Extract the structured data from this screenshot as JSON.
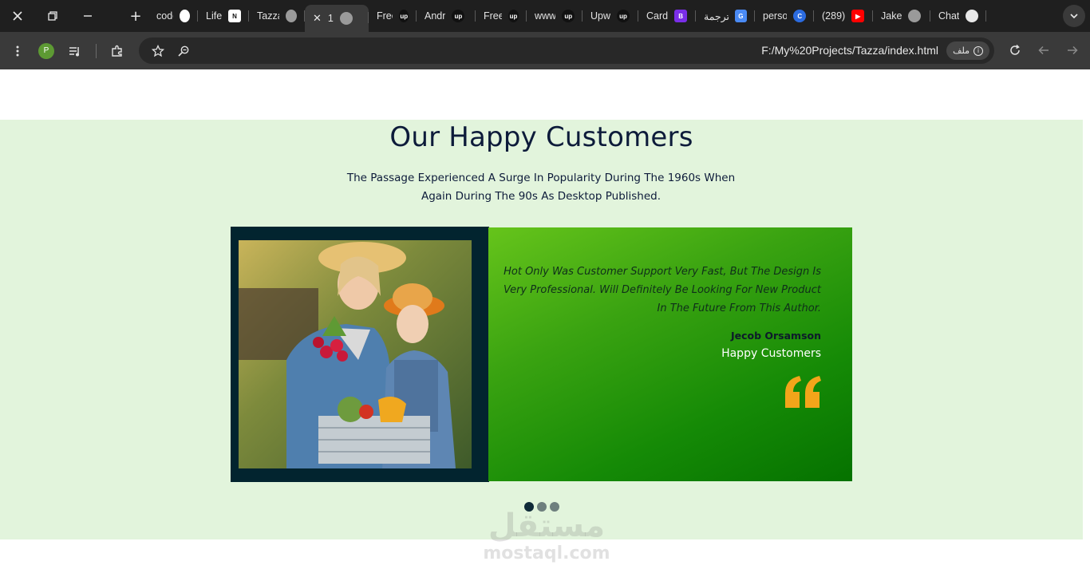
{
  "browser": {
    "tabs": [
      {
        "title": "code",
        "fav_color": "#ffffff",
        "fav_text": "",
        "fav_kind": "github"
      },
      {
        "title": "Life",
        "fav_color": "#ffffff",
        "fav_text": "N",
        "fav_kind": "notion"
      },
      {
        "title": "Tazza",
        "fav_color": "#9a9a9a",
        "fav_text": "",
        "fav_kind": "globe"
      },
      {
        "title": "1",
        "fav_color": "#9a9a9a",
        "fav_text": "",
        "fav_kind": "globe",
        "active": true
      },
      {
        "title": "Freel",
        "fav_color": "#111111",
        "fav_text": "up",
        "fav_kind": "upwork"
      },
      {
        "title": "Andr",
        "fav_color": "#111111",
        "fav_text": "up",
        "fav_kind": "upwork"
      },
      {
        "title": "Freel",
        "fav_color": "#111111",
        "fav_text": "up",
        "fav_kind": "upwork"
      },
      {
        "title": "www",
        "fav_color": "#111111",
        "fav_text": "up",
        "fav_kind": "upwork"
      },
      {
        "title": "Upw",
        "fav_color": "#111111",
        "fav_text": "up",
        "fav_kind": "upwork"
      },
      {
        "title": "Card",
        "fav_color": "#7a2ee8",
        "fav_text": "B",
        "fav_kind": "bootstrap"
      },
      {
        "title": "ترجمة",
        "fav_color": "#4a8af4",
        "fav_text": "G",
        "fav_kind": "translate"
      },
      {
        "title": "perso",
        "fav_color": "#2b6be0",
        "fav_text": "C",
        "fav_kind": "canva"
      },
      {
        "title": "(289)",
        "fav_color": "#ff0000",
        "fav_text": "▶",
        "fav_kind": "youtube"
      },
      {
        "title": "Jake",
        "fav_color": "#9a9a9a",
        "fav_text": "",
        "fav_kind": "globe"
      },
      {
        "title": "Chat",
        "fav_color": "#e8e8e8",
        "fav_text": "",
        "fav_kind": "openai"
      }
    ],
    "profile_initial": "P",
    "url": "F:/My%20Projects/Tazza/index.html",
    "site_chip_label": "ملف"
  },
  "section": {
    "title": "Our Happy Customers",
    "subtitle": "The Passage Experienced A Surge In Popularity During The 1960s When Again During The 90s As Desktop Published."
  },
  "testimonial": {
    "quote": "Hot Only Was Customer Support Very Fast, But The Design Is Very Professional. Will Definitely Be Looking For New Product In The Future From This Author.",
    "author": "Jecob Orsamson",
    "role": "Happy Customers",
    "quote_mark_color": "#f2a51a",
    "photo_alt": "mother-and-daughter-with-vegetable-crate"
  },
  "slider": {
    "count": 3,
    "active_index": 0
  },
  "watermark": {
    "arabic": "مستقل",
    "latin": "mostaql.com"
  }
}
